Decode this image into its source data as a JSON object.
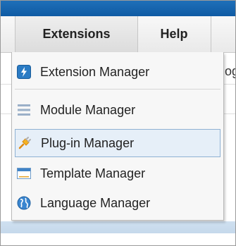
{
  "menubar": {
    "tabs": [
      {
        "label": "Extensions"
      },
      {
        "label": "Help"
      }
    ]
  },
  "background": {
    "snippet": "og"
  },
  "dropdown": {
    "items": [
      {
        "label": "Extension Manager",
        "icon": "extension-manager-icon"
      },
      {
        "label": "Module Manager",
        "icon": "module-manager-icon"
      },
      {
        "label": "Plug-in Manager",
        "icon": "plugin-manager-icon",
        "selected": true
      },
      {
        "label": "Template Manager",
        "icon": "template-manager-icon"
      },
      {
        "label": "Language Manager",
        "icon": "language-manager-icon"
      }
    ]
  },
  "colors": {
    "topbar": "#1565b0",
    "selection": "#e6eff8",
    "selection_border": "#8fb1d3"
  }
}
